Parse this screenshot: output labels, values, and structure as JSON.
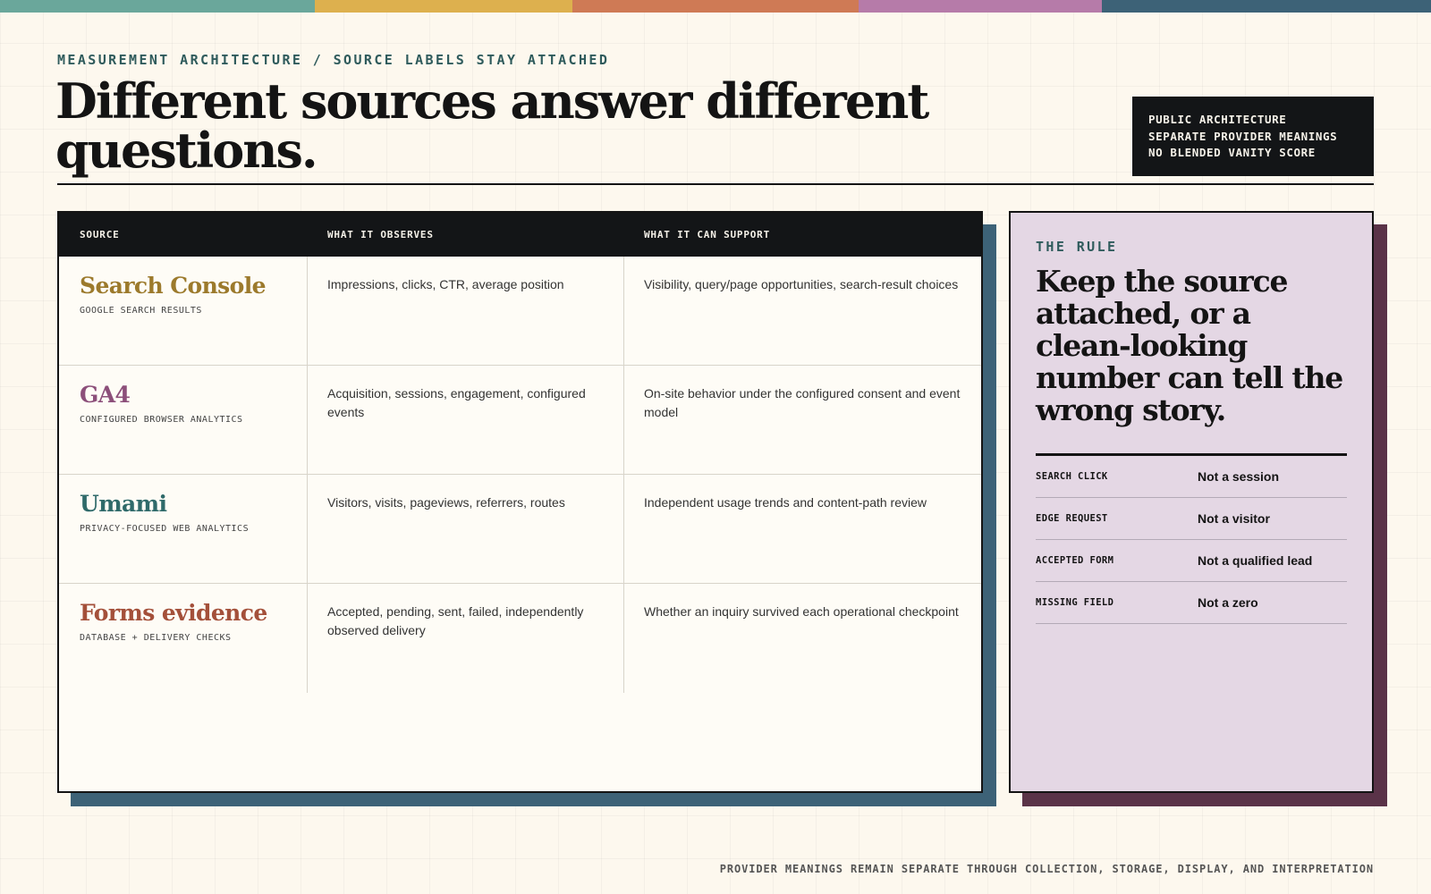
{
  "colors": {
    "strip": [
      "#6aa79b",
      "#ddb04e",
      "#cf7a55",
      "#b67ba9",
      "#3d6277"
    ],
    "table_shadow": "#3d6277",
    "rule_card_bg": "#e4d7e4",
    "rule_shadow": "#5a3348",
    "eyebrow": "#2f5b5c"
  },
  "header": {
    "eyebrow": "MEASUREMENT ARCHITECTURE / SOURCE LABELS STAY ATTACHED",
    "title_line1": "Different sources answer different",
    "title_line2": "questions.",
    "tags": [
      "PUBLIC ARCHITECTURE",
      "SEPARATE PROVIDER MEANINGS",
      "NO BLENDED VANITY SCORE"
    ]
  },
  "table": {
    "headers": [
      "SOURCE",
      "WHAT IT OBSERVES",
      "WHAT IT CAN SUPPORT"
    ],
    "rows": [
      {
        "name": "Search Console",
        "subtitle": "GOOGLE SEARCH RESULTS",
        "color": "#9c7a2c",
        "observes": "Impressions, clicks, CTR, average position",
        "supports": "Visibility, query/page opportunities, search-result choices"
      },
      {
        "name": "GA4",
        "subtitle": "CONFIGURED BROWSER ANALYTICS",
        "color": "#8c4f7a",
        "observes": "Acquisition, sessions, engagement, configured events",
        "supports": "On-site behavior under the configured consent and event model"
      },
      {
        "name": "Umami",
        "subtitle": "PRIVACY-FOCUSED WEB ANALYTICS",
        "color": "#2f6a6a",
        "observes": "Visitors, visits, pageviews, referrers, routes",
        "supports": "Independent usage trends and content-path review"
      },
      {
        "name": "Forms evidence",
        "subtitle": "DATABASE + DELIVERY CHECKS",
        "color": "#a4503a",
        "observes": "Accepted, pending, sent, failed, independently observed delivery",
        "supports": "Whether an inquiry survived each operational checkpoint"
      }
    ]
  },
  "rule": {
    "eyebrow": "THE RULE",
    "statement": "Keep the source attached, or a clean-looking number can tell the wrong story.",
    "meanings": [
      {
        "key": "SEARCH CLICK",
        "value": "Not a session"
      },
      {
        "key": "EDGE REQUEST",
        "value": "Not a visitor"
      },
      {
        "key": "ACCEPTED FORM",
        "value": "Not a qualified lead"
      },
      {
        "key": "MISSING FIELD",
        "value": "Not a zero"
      }
    ]
  },
  "footer": {
    "note": "PROVIDER MEANINGS REMAIN SEPARATE THROUGH COLLECTION, STORAGE, DISPLAY, AND INTERPRETATION"
  }
}
